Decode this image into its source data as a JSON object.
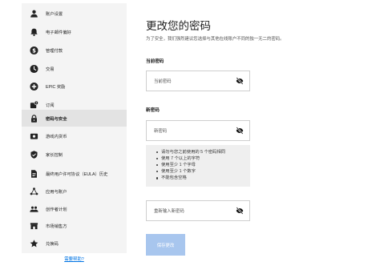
{
  "sidebar": {
    "items": [
      {
        "label": "账户设置",
        "icon": "person-icon"
      },
      {
        "label": "电子邮件偏好",
        "icon": "bell-icon"
      },
      {
        "label": "管理付款",
        "icon": "dollar-icon"
      },
      {
        "label": "交易",
        "icon": "clock-icon"
      },
      {
        "label": "EPIC 奖励",
        "icon": "plus-circle-icon"
      },
      {
        "label": "订阅",
        "icon": "subscription-icon"
      },
      {
        "label": "密码与安全",
        "icon": "lock-icon"
      },
      {
        "label": "游戏内货币",
        "icon": "currency-icon"
      },
      {
        "label": "家长控制",
        "icon": "shield-icon"
      },
      {
        "label": "最终用户许可协议（EULA）历史",
        "icon": "document-icon"
      },
      {
        "label": "应用与账户",
        "icon": "apps-icon"
      },
      {
        "label": "创作者计划",
        "icon": "people-icon"
      },
      {
        "label": "市场销售方",
        "icon": "storefront-icon"
      },
      {
        "label": "兑换码",
        "icon": "star-icon"
      }
    ],
    "active_index": 6,
    "help_link": "需要帮助?"
  },
  "main": {
    "title": "更改您的密码",
    "description": "为了安全，我们强烈建议您选择与其他在线账户不同的独一无二的密码。",
    "current_section": {
      "label": "当前密码",
      "placeholder": "当前密码"
    },
    "new_section": {
      "label": "新密码",
      "placeholder": "新密码"
    },
    "rules": [
      "请勿与您之前使用的 5 个密码相同",
      "使用 7 个以上的字符",
      "使用至少 1 个字母",
      "使用至少 1 个数字",
      "不能包含空格"
    ],
    "confirm_placeholder": "重新输入新密码",
    "save_label": "保存更改"
  },
  "colors": {
    "sidebar_bg": "#f4f4f4",
    "active_item_bg": "#e3e3e3",
    "link": "#0074e4",
    "button_disabled": "#a8c6ee"
  }
}
